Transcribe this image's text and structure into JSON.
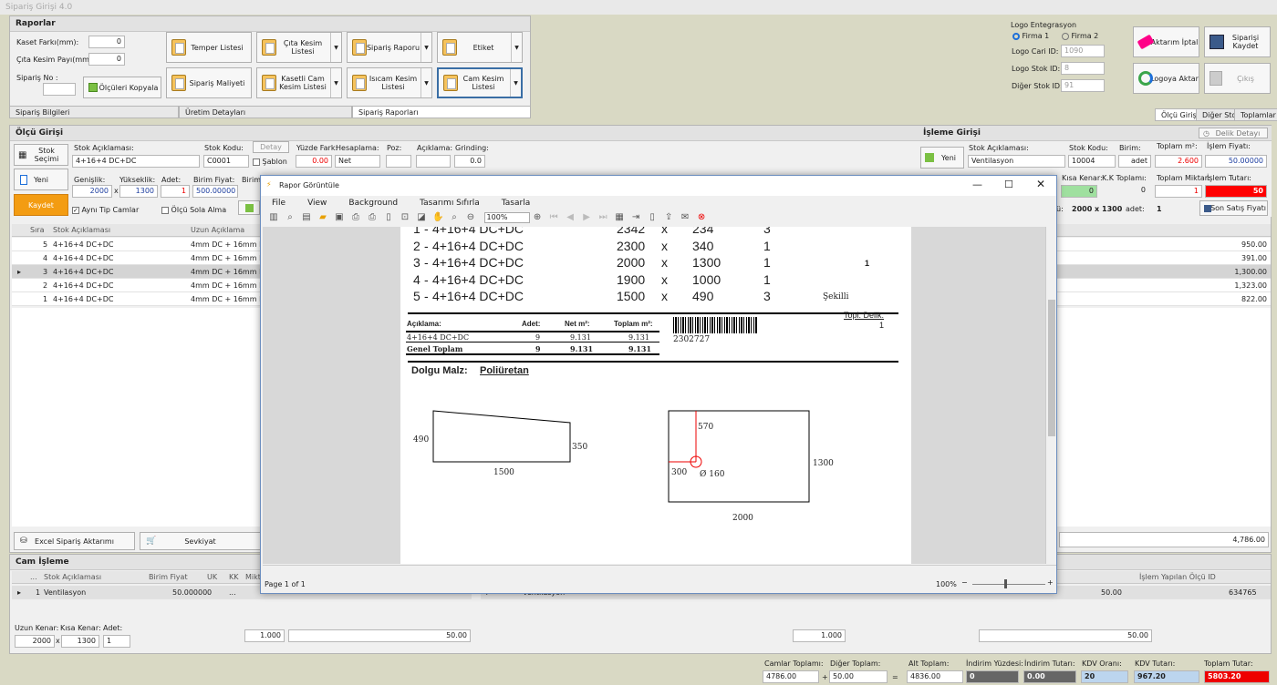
{
  "title": "Sipariş Girişi 4.0",
  "raporlar": {
    "header": "Raporlar",
    "kaset_label": "Kaset Farkı(mm):",
    "kaset_val": "0",
    "cita_label": "Çıta Kesim Payı(mm):",
    "cita_val": "0",
    "siparis_label": "Sipariş No :",
    "siparis_val": "",
    "b_olcu": "Ölçüleri Kopyala",
    "b_temper": "Temper Listesi",
    "b_cita": "Çıta Kesim Listesi",
    "b_sraporu": "Sipariş Raporu",
    "b_etiket": "Etiket",
    "b_maliyet": "Sipariş Maliyeti",
    "b_kaset": "Kasetli Cam Kesim Listesi",
    "b_iscam": "Isıcam Kesim Listesi",
    "b_camkesim": "Cam Kesim Listesi",
    "tabs": [
      "Sipariş Bilgileri",
      "Üretim Detayları",
      "Sipariş Raporları"
    ]
  },
  "logo": {
    "header": "Logo Entegrasyon",
    "firma1": "Firma 1",
    "firma2": "Firma 2",
    "cari_label": "Logo Cari ID:",
    "cari": "1090",
    "stok_label": "Logo Stok ID:",
    "stok": "8",
    "diger_label": "Diğer Stok ID:",
    "diger": "91",
    "b_iptal": "Aktarım İptal",
    "b_kaydet": "Siparişi Kaydet",
    "b_aktar": "Logoya Aktar",
    "b_cikis": "Çıkış"
  },
  "righttabs": [
    "Ölçü Girişi",
    "Diğer Stok",
    "Toplamlar"
  ],
  "olcu": {
    "header": "Ölçü Girişi",
    "b_stok": "Stok Seçimi",
    "b_yeni": "Yeni",
    "b_kaydet": "Kaydet",
    "stokack_label": "Stok Açıklaması:",
    "stokack": "4+16+4 DC+DC",
    "stokkod_label": "Stok Kodu:",
    "stokkod": "C0001",
    "detay": "Detay",
    "sablon": "Şablon",
    "yuzde_label": "Yüzde Fark:",
    "yuzde": "0.00",
    "hesap_label": "Hesaplama:",
    "hesap": "Net",
    "poz_label": "Poz:",
    "ack_label": "Açıklama:",
    "grind_label": "Grinding:",
    "grind": "0.0",
    "gen_label": "Genişlik:",
    "gen": "2000",
    "yuk_label": "Yükseklik:",
    "yuk": "1300",
    "adet_label": "Adet:",
    "adet": "1",
    "bf_label": "Birim Fiyat:",
    "bf": "500.00000",
    "birim_label": "Birim",
    "ayni": "Aynı Tip Camlar",
    "sola": "Ölçü Sola Alma",
    "cols": [
      "Sıra",
      "Stok Açıklaması",
      "Uzun Açıklama"
    ],
    "rows": [
      {
        "n": "5",
        "s": "4+16+4 DC+DC",
        "u": "4mm DC + 16mm HB",
        "t": "950.00"
      },
      {
        "n": "4",
        "s": "4+16+4 DC+DC",
        "u": "4mm DC + 16mm HB",
        "t": "391.00"
      },
      {
        "n": "3",
        "s": "4+16+4 DC+DC",
        "u": "4mm DC + 16mm HB",
        "t": "1,300.00"
      },
      {
        "n": "2",
        "s": "4+16+4 DC+DC",
        "u": "4mm DC + 16mm HB",
        "t": "1,323.00"
      },
      {
        "n": "1",
        "s": "4+16+4 DC+DC",
        "u": "4mm DC + 16mm HB",
        "t": "822.00"
      }
    ],
    "b_excel": "Excel Sipariş Aktarımı",
    "b_sevk": "Sevkiyat",
    "total": "4,786.00"
  },
  "isleme": {
    "header": "İşleme Girişi",
    "delik": "Delik Detayı",
    "b_yeni": "Yeni",
    "stokack_label": "Stok Açıklaması:",
    "stokack": "Ventilasyon",
    "stokkod_label": "Stok Kodu:",
    "stokkod": "10004",
    "birim_label": "Birim:",
    "birim": "adet",
    "tm_label": "Toplam m²:",
    "tm": "2.600",
    "if_label": "İşlem Fiyatı:",
    "if": "50.00000",
    "kisa_label": "Kısa Kenar:",
    "kisa": "0",
    "kk_label": "K.K Toplamı:",
    "kk": "0",
    "tmik_label": "Toplam Miktar:",
    "tmik": "1",
    "it_label": "İşlem Tutarı:",
    "it": "50",
    "olcu_lbl": "ü:",
    "olcu_val": "2000 x 1300",
    "adet_lbl": "adet:",
    "adet_val": "1",
    "b_son": "Son Satış Fiyatı"
  },
  "cam": {
    "header": "Cam İşleme",
    "cols": [
      "Stok Açıklaması",
      "Birim Fiyat",
      "UK",
      "KK",
      "Mikt"
    ],
    "row": {
      "n": "1",
      "s": "Ventilasyon",
      "bf": "50.00000",
      "uk": "0",
      "kk": "..."
    },
    "rcol": "İşlem Yapılan Ölçü ID",
    "rrow_s": "Ventilasyon",
    "rrow_t": "50.00",
    "rrow_id": "634765",
    "uzun_label": "Uzun Kenar:",
    "uzun": "2000",
    "kisa_label": "Kısa Kenar:",
    "kisa": "1300",
    "adet_label": "Adet:",
    "adet": "1",
    "t1": "1.000",
    "t2": "50.00",
    "t3": "1.000",
    "t4": "50.00"
  },
  "totals": {
    "camlar_label": "Camlar Toplamı:",
    "camlar": "4786.00",
    "diger_label": "Diğer Toplam:",
    "diger": "50.00",
    "alt_label": "Alt Toplam:",
    "alt": "4836.00",
    "iy_label": "İndirim Yüzdesi:",
    "iy": "0",
    "it_label": "İndirim Tutarı:",
    "it": "0.00",
    "kdvo_label": "KDV Oranı:",
    "kdvo": "20",
    "kdvt_label": "KDV Tutarı:",
    "kdvt": "967.20",
    "top_label": "Toplam Tutar:",
    "top": "5803.20"
  },
  "viewer": {
    "title": "Rapor Görüntüle",
    "menu": [
      "File",
      "View",
      "Background",
      "Tasarımı Sıfırla",
      "Tasarla"
    ],
    "zoom": "100%",
    "page": "Page 1 of 1",
    "zoom2": "100%",
    "lines": [
      {
        "n": "1",
        "s": "4+16+4 DC+DC",
        "w": "2342",
        "h": "234",
        "a": "3",
        "e": ""
      },
      {
        "n": "2",
        "s": "4+16+4 DC+DC",
        "w": "2300",
        "h": "340",
        "a": "1",
        "e": ""
      },
      {
        "n": "3",
        "s": "4+16+4 DC+DC",
        "w": "2000",
        "h": "1300",
        "a": "1",
        "e": "1"
      },
      {
        "n": "4",
        "s": "4+16+4 DC+DC",
        "w": "1900",
        "h": "1000",
        "a": "1",
        "e": ""
      },
      {
        "n": "5",
        "s": "4+16+4 DC+DC",
        "w": "1500",
        "h": "490",
        "a": "3",
        "e": "Şekilli"
      }
    ],
    "tbl_h": [
      "Açıklama:",
      "Adet:",
      "Net m²:",
      "Toplam m²:"
    ],
    "tbl_r": [
      "4+16+4 DC+DC",
      "9",
      "9.131",
      "9.131"
    ],
    "tbl_g": [
      "Genel Toplam",
      "9",
      "9.131",
      "9.131"
    ],
    "barcode": "2302727",
    "topl": "Topl. Delik:",
    "topl_v": "1",
    "dolgu_l": "Dolgu Malz:",
    "dolgu": "Poliüretan",
    "s1_l": "490",
    "s1_r": "350",
    "s1_b": "1500",
    "s2_t": "570",
    "s2_l": "300",
    "s2_c": "Ø 160",
    "s2_r": "1300",
    "s2_b": "2000"
  }
}
